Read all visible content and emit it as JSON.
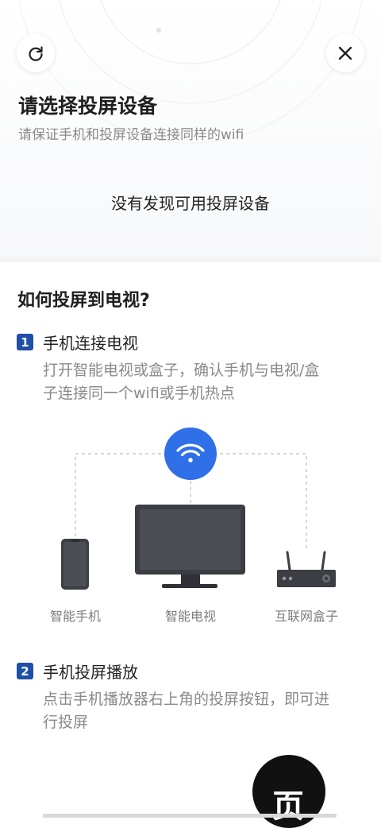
{
  "header": {
    "title": "请选择投屏设备",
    "subtitle": "请保证手机和投屏设备连接同样的wifi",
    "refresh_icon": "refresh-icon",
    "close_icon": "close-icon"
  },
  "device_list": {
    "empty_message": "没有发现可用投屏设备"
  },
  "guide": {
    "title": "如何投屏到电视?",
    "steps": [
      {
        "number": "1",
        "title": "手机连接电视",
        "description_lines": [
          "打开智能电视或盒子，确认手机与电视/盒",
          "子连接同一个wifi或手机热点"
        ]
      },
      {
        "number": "2",
        "title": "手机投屏播放",
        "description_lines": [
          "点击手机播放器右上角的投屏按钮，即可进",
          "行投屏"
        ]
      }
    ],
    "diagram": {
      "labels": [
        "智能手机",
        "智能电视",
        "互联网盒子"
      ],
      "accent_color": "#2f6fe8"
    }
  },
  "floating_button": {
    "glyph": "页"
  }
}
